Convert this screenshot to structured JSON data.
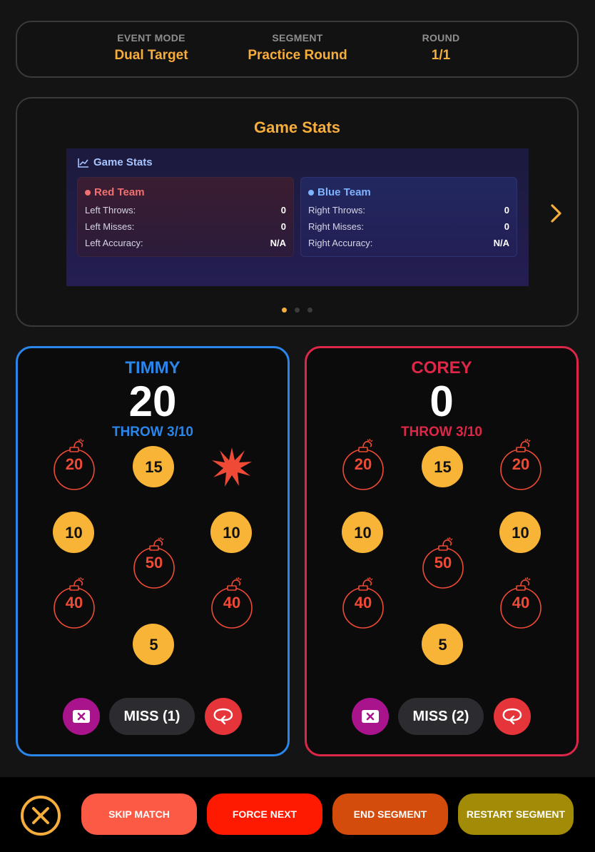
{
  "header": {
    "mode_label": "EVENT MODE",
    "mode_value": "Dual Target",
    "segment_label": "SEGMENT",
    "segment_value": "Practice Round",
    "round_label": "ROUND",
    "round_value": "1/1"
  },
  "stats_panel": {
    "title": "Game Stats",
    "slide_heading": "Game Stats",
    "active_slide": 1,
    "slide_count": 3,
    "red_team": {
      "name": "Red Team",
      "color": "#f07070",
      "rows": [
        {
          "label": "Left Throws:",
          "value": "0"
        },
        {
          "label": "Left Misses:",
          "value": "0"
        },
        {
          "label": "Left Accuracy:",
          "value": "N/A"
        }
      ]
    },
    "blue_team": {
      "name": "Blue Team",
      "color": "#7fb2ff",
      "rows": [
        {
          "label": "Right Throws:",
          "value": "0"
        },
        {
          "label": "Right Misses:",
          "value": "0"
        },
        {
          "label": "Right Accuracy:",
          "value": "N/A"
        }
      ]
    }
  },
  "players": [
    {
      "name": "TIMMY",
      "score": "20",
      "throw": "THROW 3/10",
      "color": "#2a86ea",
      "targets": [
        {
          "kind": "bomb",
          "value": "20"
        },
        {
          "kind": "coin",
          "value": "15"
        },
        {
          "kind": "hit",
          "icon": "explosion-icon"
        },
        {
          "kind": "coin",
          "value": "10"
        },
        {
          "kind": "coin",
          "value": "10"
        },
        {
          "kind": "bomb",
          "value": "50"
        },
        {
          "kind": "bomb",
          "value": "40"
        },
        {
          "kind": "bomb",
          "value": "40"
        },
        {
          "kind": "coin",
          "value": "5"
        }
      ],
      "miss_label": "MISS (1)"
    },
    {
      "name": "COREY",
      "score": "0",
      "throw": "THROW 3/10",
      "color": "#dc2748",
      "targets": [
        {
          "kind": "bomb",
          "value": "20"
        },
        {
          "kind": "coin",
          "value": "15"
        },
        {
          "kind": "bomb",
          "value": "20"
        },
        {
          "kind": "coin",
          "value": "10"
        },
        {
          "kind": "coin",
          "value": "10"
        },
        {
          "kind": "bomb",
          "value": "50"
        },
        {
          "kind": "bomb",
          "value": "40"
        },
        {
          "kind": "bomb",
          "value": "40"
        },
        {
          "kind": "coin",
          "value": "5"
        }
      ],
      "miss_label": "MISS (2)"
    }
  ],
  "footer": {
    "skip_label": "SKIP MATCH",
    "skip_color": "#fd5a46",
    "force_label": "FORCE NEXT",
    "force_color": "#fe1a00",
    "end_label": "END SEGMENT",
    "end_color": "#d34c0b",
    "restart_label": "RESTART SEGMENT",
    "restart_color": "#a28c07"
  }
}
